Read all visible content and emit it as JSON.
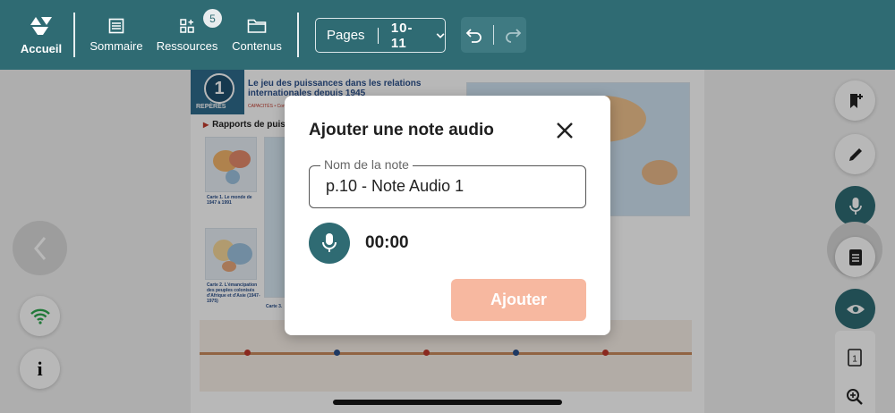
{
  "topbar": {
    "home_label": "Accueil",
    "nav": [
      {
        "label": "Sommaire",
        "icon": "list-icon"
      },
      {
        "label": "Ressources",
        "icon": "resources-icon",
        "badge": "5"
      },
      {
        "label": "Contenus",
        "icon": "folder-icon"
      }
    ],
    "pages_label": "Pages",
    "pages_value": "10-11"
  },
  "document": {
    "theme_number": "1",
    "theme_tag": "REPÈRES",
    "title": "Le jeu des puissances dans les relations internationales depuis 1945",
    "capacites": "CAPACITÉS • Connaître le",
    "section_heading": "Rapports de puissa",
    "carte1": "Carte 1. Le monde de 1947 à 1991",
    "carte2": "Carte 2. L'émancipation des peuples colonisés d'Afrique et d'Asie (1947-1975)",
    "carte3": "Carte 3."
  },
  "modal": {
    "title": "Ajouter une note audio",
    "field_label": "Nom de la note",
    "field_value": "p.10 - Note Audio 1",
    "timer": "00:00",
    "add_label": "Ajouter"
  },
  "colors": {
    "teal": "#2f6b73",
    "add_button": "#f7b8a0"
  }
}
